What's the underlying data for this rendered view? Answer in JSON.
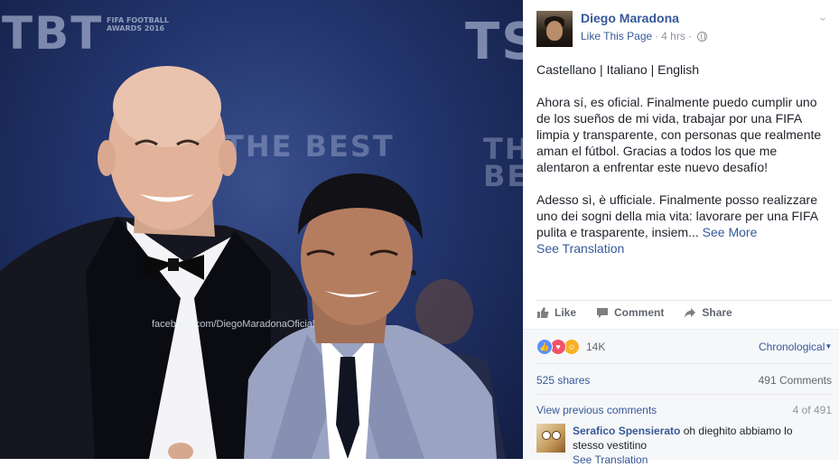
{
  "photo": {
    "watermark_text": "facebook.com/DiegoMaradonaOficial",
    "event_text": "THE BEST",
    "event_subtext": "FIFA FOOTBALL AWARDS 2016"
  },
  "post": {
    "author": "Diego Maradona",
    "like_page": "Like This Page",
    "separator": "·",
    "time": "4 hrs",
    "separator2": "·",
    "languages": "Castellano | Italiano | English",
    "paragraph_es": "Ahora sí, es oficial. Finalmente puedo cumplir uno de los sueños de mi vida, trabajar por una FIFA limpia y transparente, con personas que realmente aman el fútbol. Gracias a todos los que me alentaron a enfrentar este nuevo desafío!",
    "paragraph_it": "Adesso sì, è ufficiale. Finalmente posso realizzare uno dei sogni della mia vita: lavorare per una FIFA pulita e trasparente, insiem...",
    "see_more": "See More",
    "see_translation": "See Translation"
  },
  "actions": {
    "like": "Like",
    "comment": "Comment",
    "share": "Share"
  },
  "stats": {
    "reaction_count": "14K",
    "order": "Chronological",
    "shares": "525 shares",
    "comments": "491 Comments"
  },
  "comments": {
    "view_previous": "View previous comments",
    "pager": "4 of 491",
    "items": [
      {
        "author": "Serafico Spensierato",
        "text": "oh dieghito abbiamo lo stesso vestitino",
        "see_translation": "See Translation"
      }
    ]
  },
  "colors": {
    "link": "#365899",
    "secondary": "#90949c",
    "action": "#616770",
    "photo_bg": "#22356d"
  },
  "icons": [
    "chevron-down-icon",
    "globe-icon",
    "thumb-up-icon",
    "comment-icon",
    "share-arrow-icon",
    "like-reaction-icon",
    "love-reaction-icon",
    "haha-reaction-icon"
  ]
}
